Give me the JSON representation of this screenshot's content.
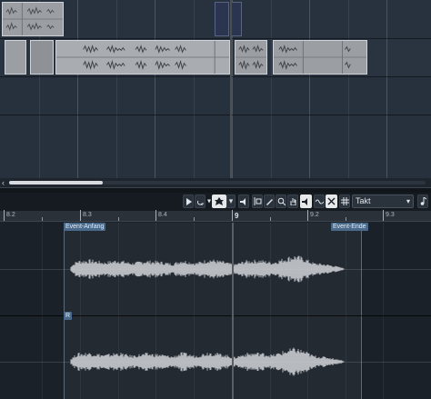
{
  "toolbar": {
    "play_icon": "play-icon",
    "loop_icon": "loop-icon",
    "tool_select_icon": "speaker-icon",
    "snap_label": "Takt",
    "snap_arrow": "▾",
    "tool_arrow": "▾"
  },
  "ruler": {
    "labels": [
      "8.2",
      "8.3",
      "8.4",
      "9",
      "9.2",
      "9.3"
    ]
  },
  "editor": {
    "event_start_label": "Event-Anfang",
    "event_end_label": "Event-Ende",
    "channel_r_label": "R"
  },
  "colors": {
    "arrange_bg": "#27313d",
    "event_fill": "#9b9ea3",
    "waveform": "#c9ccd0",
    "tag_blue": "#4a6a8c"
  }
}
